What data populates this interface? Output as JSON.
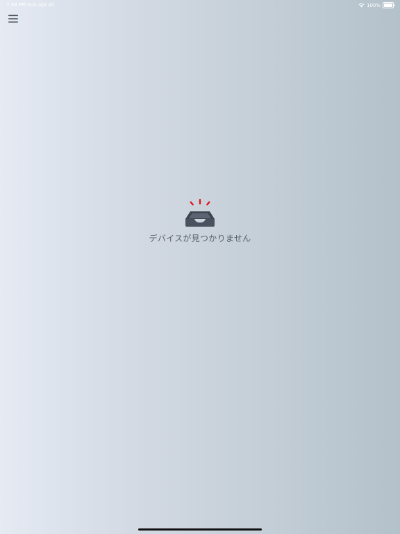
{
  "status_bar": {
    "time": "7:38 PM   Sun Apr 20",
    "battery": "100%",
    "wifi_icon": "wifi-icon",
    "battery_icon": "battery-icon"
  },
  "toolbar": {
    "menu_icon": "hamburger-menu-icon"
  },
  "empty_state": {
    "icon": "empty-tray-alert-icon",
    "message": "デバイスが見つかりません"
  },
  "colors": {
    "alert_red": "#e0141e",
    "tray_dark": "#4a5260",
    "text": "#5a5f66"
  }
}
